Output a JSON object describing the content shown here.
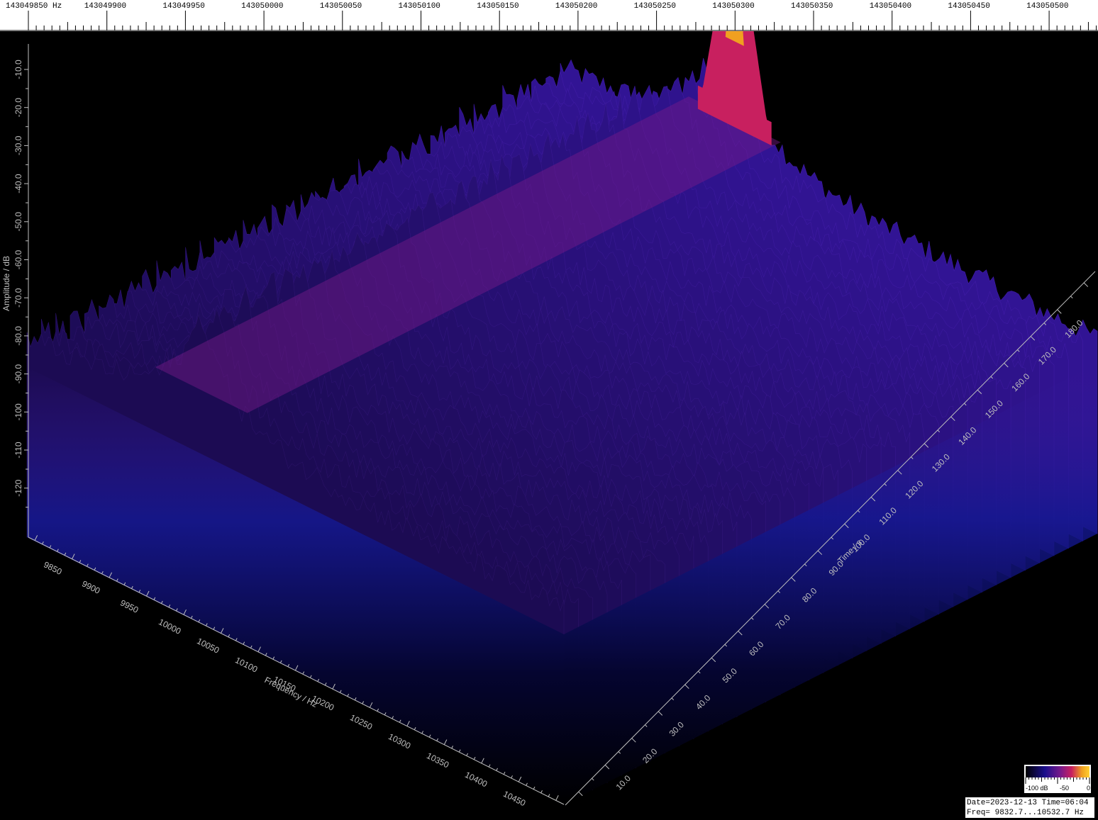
{
  "top_ruler": {
    "unit": "Hz",
    "labels": [
      "143049850 Hz",
      "143049900",
      "143049950",
      "143050000",
      "143050050",
      "143050100",
      "143050150",
      "143050200",
      "143050250",
      "143050300",
      "143050350",
      "143050400",
      "143050450",
      "143050500"
    ]
  },
  "chart_data": {
    "type": "waterfall-3d",
    "xlabel": "Frequency / Hz",
    "ylabel": "Amplitude / dB",
    "zlabel": "Time / s",
    "frequency_ticks": [
      "9850",
      "9900",
      "9950",
      "10000",
      "10050",
      "10100",
      "10150",
      "10200",
      "10250",
      "10300",
      "10350",
      "10400",
      "10450"
    ],
    "amplitude_ticks": [
      "-10.0",
      "-20.0",
      "-30.0",
      "-40.0",
      "-50.0",
      "-60.0",
      "-70.0",
      "-80.0",
      "-90.0",
      "-100",
      "-110",
      "-120"
    ],
    "time_ticks": [
      "10.0",
      "20.0",
      "30.0",
      "40.0",
      "50.0",
      "60.0",
      "70.0",
      "80.0",
      "90.0",
      "100.0",
      "110.0",
      "120.0",
      "130.0",
      "140.0",
      "150.0",
      "160.0",
      "170.0",
      "180.0"
    ],
    "frequency_range": [
      9832.7,
      10532.7
    ],
    "amplitude_range": [
      -130,
      0
    ],
    "time_range": [
      0,
      190
    ],
    "noise_floor_db": -80,
    "peak": {
      "frequency": 10060,
      "amplitude_db": -14,
      "time_from": 0,
      "time_to": 190
    },
    "colors": {
      "low": "#000000",
      "mid_low": "#1a0f8c",
      "mid": "#7a1a8a",
      "mid_high": "#c8205f",
      "high": "#f0a020",
      "peak": "#ffd030"
    }
  },
  "colorbar": {
    "labels": [
      "-100 dB",
      "-50",
      "0"
    ]
  },
  "info": {
    "line1": "Date=2023-12-13 Time=06:04",
    "line2": "Freq= 9832.7...10532.7 Hz"
  }
}
